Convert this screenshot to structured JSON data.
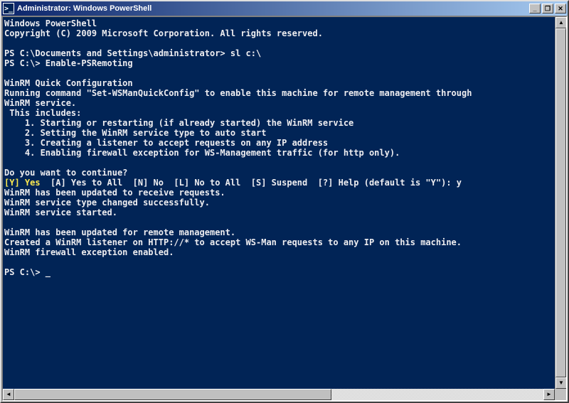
{
  "window": {
    "title": "Administrator: Windows PowerShell",
    "icon_glyph": ">_"
  },
  "buttons": {
    "minimize": "_",
    "maximize": "❐",
    "close": "✕"
  },
  "console": {
    "lines": [
      "Windows PowerShell",
      "Copyright (C) 2009 Microsoft Corporation. All rights reserved.",
      "",
      "PS C:\\Documents and Settings\\administrator> sl c:\\",
      "PS C:\\> Enable-PSRemoting",
      "",
      "WinRM Quick Configuration",
      "Running command \"Set-WSManQuickConfig\" to enable this machine for remote management through",
      "WinRM service.",
      " This includes:",
      "    1. Starting or restarting (if already started) the WinRM service",
      "    2. Setting the WinRM service type to auto start",
      "    3. Creating a listener to accept requests on any IP address",
      "    4. Enabling firewall exception for WS-Management traffic (for http only).",
      "",
      "Do you want to continue?"
    ],
    "prompt_highlight": "[Y] Yes",
    "prompt_rest": "  [A] Yes to All  [N] No  [L] No to All  [S] Suspend  [?] Help (default is \"Y\"): y",
    "lines_after": [
      "WinRM has been updated to receive requests.",
      "WinRM service type changed successfully.",
      "WinRM service started.",
      "",
      "WinRM has been updated for remote management.",
      "Created a WinRM listener on HTTP://* to accept WS-Man requests to any IP on this machine.",
      "WinRM firewall exception enabled.",
      "",
      "PS C:\\> _"
    ]
  },
  "scroll": {
    "up": "▲",
    "down": "▼",
    "left": "◄",
    "right": "►"
  }
}
